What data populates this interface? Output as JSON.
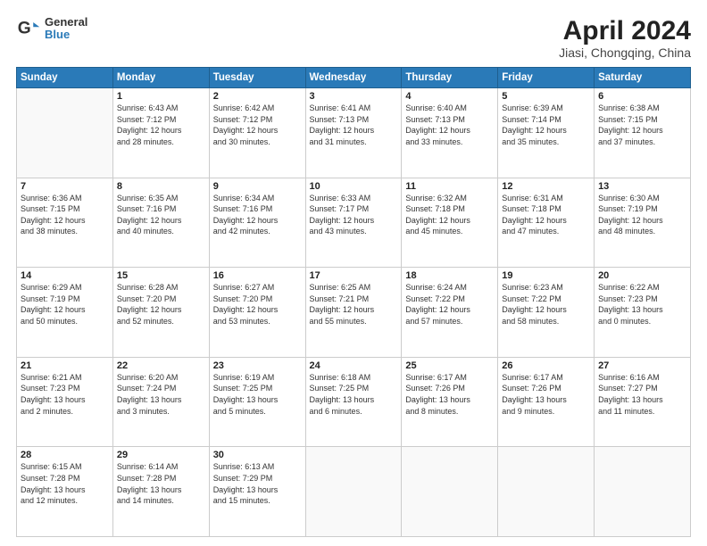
{
  "header": {
    "logo_line1": "General",
    "logo_line2": "Blue",
    "title": "April 2024",
    "subtitle": "Jiasi, Chongqing, China"
  },
  "calendar": {
    "days_of_week": [
      "Sunday",
      "Monday",
      "Tuesday",
      "Wednesday",
      "Thursday",
      "Friday",
      "Saturday"
    ],
    "weeks": [
      [
        {
          "day": "",
          "info": ""
        },
        {
          "day": "1",
          "info": "Sunrise: 6:43 AM\nSunset: 7:12 PM\nDaylight: 12 hours\nand 28 minutes."
        },
        {
          "day": "2",
          "info": "Sunrise: 6:42 AM\nSunset: 7:12 PM\nDaylight: 12 hours\nand 30 minutes."
        },
        {
          "day": "3",
          "info": "Sunrise: 6:41 AM\nSunset: 7:13 PM\nDaylight: 12 hours\nand 31 minutes."
        },
        {
          "day": "4",
          "info": "Sunrise: 6:40 AM\nSunset: 7:13 PM\nDaylight: 12 hours\nand 33 minutes."
        },
        {
          "day": "5",
          "info": "Sunrise: 6:39 AM\nSunset: 7:14 PM\nDaylight: 12 hours\nand 35 minutes."
        },
        {
          "day": "6",
          "info": "Sunrise: 6:38 AM\nSunset: 7:15 PM\nDaylight: 12 hours\nand 37 minutes."
        }
      ],
      [
        {
          "day": "7",
          "info": "Sunrise: 6:36 AM\nSunset: 7:15 PM\nDaylight: 12 hours\nand 38 minutes."
        },
        {
          "day": "8",
          "info": "Sunrise: 6:35 AM\nSunset: 7:16 PM\nDaylight: 12 hours\nand 40 minutes."
        },
        {
          "day": "9",
          "info": "Sunrise: 6:34 AM\nSunset: 7:16 PM\nDaylight: 12 hours\nand 42 minutes."
        },
        {
          "day": "10",
          "info": "Sunrise: 6:33 AM\nSunset: 7:17 PM\nDaylight: 12 hours\nand 43 minutes."
        },
        {
          "day": "11",
          "info": "Sunrise: 6:32 AM\nSunset: 7:18 PM\nDaylight: 12 hours\nand 45 minutes."
        },
        {
          "day": "12",
          "info": "Sunrise: 6:31 AM\nSunset: 7:18 PM\nDaylight: 12 hours\nand 47 minutes."
        },
        {
          "day": "13",
          "info": "Sunrise: 6:30 AM\nSunset: 7:19 PM\nDaylight: 12 hours\nand 48 minutes."
        }
      ],
      [
        {
          "day": "14",
          "info": "Sunrise: 6:29 AM\nSunset: 7:19 PM\nDaylight: 12 hours\nand 50 minutes."
        },
        {
          "day": "15",
          "info": "Sunrise: 6:28 AM\nSunset: 7:20 PM\nDaylight: 12 hours\nand 52 minutes."
        },
        {
          "day": "16",
          "info": "Sunrise: 6:27 AM\nSunset: 7:20 PM\nDaylight: 12 hours\nand 53 minutes."
        },
        {
          "day": "17",
          "info": "Sunrise: 6:25 AM\nSunset: 7:21 PM\nDaylight: 12 hours\nand 55 minutes."
        },
        {
          "day": "18",
          "info": "Sunrise: 6:24 AM\nSunset: 7:22 PM\nDaylight: 12 hours\nand 57 minutes."
        },
        {
          "day": "19",
          "info": "Sunrise: 6:23 AM\nSunset: 7:22 PM\nDaylight: 12 hours\nand 58 minutes."
        },
        {
          "day": "20",
          "info": "Sunrise: 6:22 AM\nSunset: 7:23 PM\nDaylight: 13 hours\nand 0 minutes."
        }
      ],
      [
        {
          "day": "21",
          "info": "Sunrise: 6:21 AM\nSunset: 7:23 PM\nDaylight: 13 hours\nand 2 minutes."
        },
        {
          "day": "22",
          "info": "Sunrise: 6:20 AM\nSunset: 7:24 PM\nDaylight: 13 hours\nand 3 minutes."
        },
        {
          "day": "23",
          "info": "Sunrise: 6:19 AM\nSunset: 7:25 PM\nDaylight: 13 hours\nand 5 minutes."
        },
        {
          "day": "24",
          "info": "Sunrise: 6:18 AM\nSunset: 7:25 PM\nDaylight: 13 hours\nand 6 minutes."
        },
        {
          "day": "25",
          "info": "Sunrise: 6:17 AM\nSunset: 7:26 PM\nDaylight: 13 hours\nand 8 minutes."
        },
        {
          "day": "26",
          "info": "Sunrise: 6:17 AM\nSunset: 7:26 PM\nDaylight: 13 hours\nand 9 minutes."
        },
        {
          "day": "27",
          "info": "Sunrise: 6:16 AM\nSunset: 7:27 PM\nDaylight: 13 hours\nand 11 minutes."
        }
      ],
      [
        {
          "day": "28",
          "info": "Sunrise: 6:15 AM\nSunset: 7:28 PM\nDaylight: 13 hours\nand 12 minutes."
        },
        {
          "day": "29",
          "info": "Sunrise: 6:14 AM\nSunset: 7:28 PM\nDaylight: 13 hours\nand 14 minutes."
        },
        {
          "day": "30",
          "info": "Sunrise: 6:13 AM\nSunset: 7:29 PM\nDaylight: 13 hours\nand 15 minutes."
        },
        {
          "day": "",
          "info": ""
        },
        {
          "day": "",
          "info": ""
        },
        {
          "day": "",
          "info": ""
        },
        {
          "day": "",
          "info": ""
        }
      ]
    ]
  }
}
